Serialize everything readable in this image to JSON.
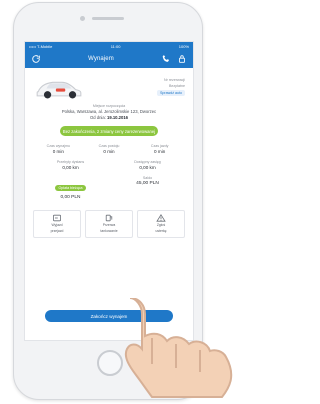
{
  "colors": {
    "brand_blue": "#1f78c8",
    "accent_green": "#8cc63f"
  },
  "statusbar": {
    "left": "••••• T-Mobile",
    "time": "11:00",
    "right": "100%"
  },
  "header": {
    "title": "Wynajem",
    "left_icon": "refresh-icon",
    "right_icons": [
      "phone-icon",
      "lock-icon"
    ]
  },
  "hero": {
    "badge_1": "Nr rezerwacji",
    "badge_2": "Bezpłatne",
    "badge_3": "Sprawdź auto"
  },
  "location": {
    "label": "Miejsce rozpoczęcia",
    "address": "Polska, Warszawa, al. Jerozolimskie 123, Dworzec",
    "date_prefix": "Od dnia:",
    "date": "19.10.2016"
  },
  "actions": {
    "green_button": "Bez zakończenia, 2 zmiany ceny zarezerwowanej"
  },
  "stats": [
    {
      "label": "Czas wynajmu",
      "value": "0 min"
    },
    {
      "label": "Czas postoju",
      "value": "0 min"
    },
    {
      "label": "Czas jazdy",
      "value": "0 min"
    }
  ],
  "distance": {
    "left_label": "Przebyty dystans",
    "left_value": "0,00 km",
    "right_label": "Dostępny zasięg",
    "right_value": "0,00 km"
  },
  "costs": {
    "left_label": "Opłata bieżąca",
    "left_value": "0,00 PLN",
    "right_label": "Saldo",
    "right_value": "45,00 PLN"
  },
  "tiles": [
    {
      "line1": "Wyjazd",
      "line2": "przejazd",
      "icon": "car-door-icon"
    },
    {
      "line1": "Przerwa",
      "line2": "tankowanie",
      "icon": "fuel-icon"
    },
    {
      "line1": "Zgłoś",
      "line2": "usterkę",
      "icon": "alert-icon"
    }
  ],
  "footer": {
    "primary_button": "Zakończ wynajem"
  }
}
